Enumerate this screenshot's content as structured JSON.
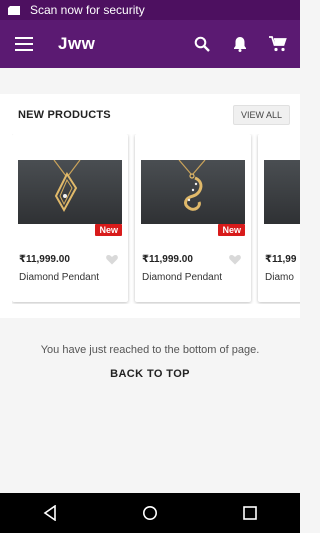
{
  "status_bar": {
    "text": "Scan now for security",
    "icon": "card-icon"
  },
  "app_bar": {
    "title": "Jww",
    "menu_icon": "menu-icon",
    "search_icon": "search-icon",
    "notification_icon": "bell-icon",
    "cart_icon": "cart-icon",
    "color": "#5b1a72"
  },
  "section": {
    "title": "NEW PRODUCTS",
    "view_all_label": "VIEW ALL",
    "products": [
      {
        "price": "₹11,999.00",
        "name": "Diamond Pendant",
        "badge": "New"
      },
      {
        "price": "₹11,999.00",
        "name": "Diamond Pendant",
        "badge": "New"
      },
      {
        "price": "₹11,99",
        "name": "Diamo",
        "badge": ""
      }
    ]
  },
  "footer": {
    "message": "You have just reached to the bottom of page.",
    "back_to_top_label": "BACK TO TOP"
  },
  "nav_bar": {
    "back_icon": "back-icon",
    "home_icon": "home-icon",
    "recents_icon": "recents-icon"
  }
}
